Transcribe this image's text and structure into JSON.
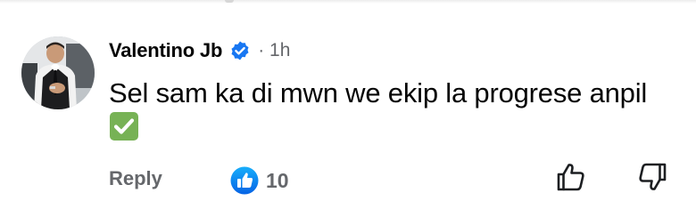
{
  "comment": {
    "author": "Valentino Jb",
    "verified_icon": "verified-badge-icon",
    "time": "· 1h",
    "text": "Sel sam ka di mwn we ekip la progrese anpil",
    "emoji": "white-check-mark-emoji"
  },
  "actions": {
    "reply_label": "Reply",
    "reaction_icon": "like-reaction-icon",
    "reaction_count": "10",
    "like_icon": "thumbs-up-outline-icon",
    "dislike_icon": "thumbs-down-outline-icon"
  },
  "colors": {
    "text": "#050505",
    "secondary": "#65676b",
    "brand_blue": "#1877f2",
    "check_green": "#77b255"
  }
}
